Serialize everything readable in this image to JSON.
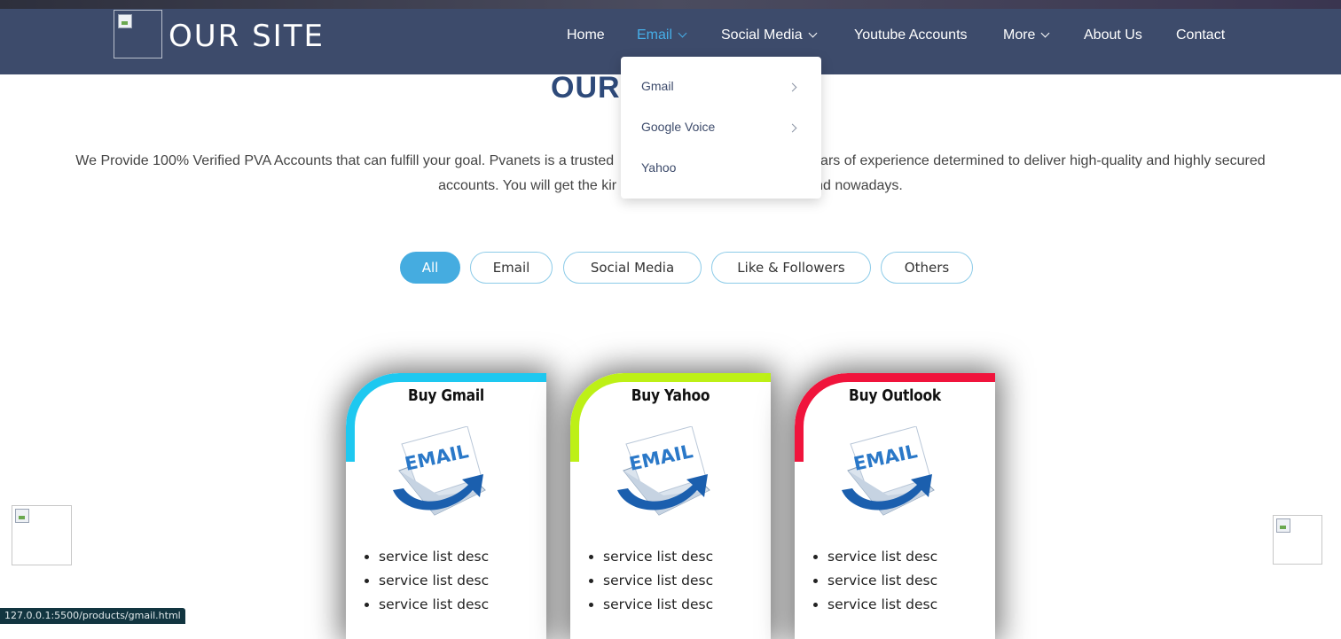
{
  "header": {
    "site_title": "OUR SITE",
    "nav": [
      "Home",
      "Email",
      "Social Media",
      "Youtube Accounts",
      "More",
      "About Us",
      "Contact"
    ],
    "active_nav": "Email"
  },
  "dropdown": {
    "items": [
      {
        "label": "Gmail",
        "has_submenu": true
      },
      {
        "label": "Google Voice",
        "has_submenu": true
      },
      {
        "label": "Yahoo",
        "has_submenu": false
      }
    ]
  },
  "section": {
    "title": "OUR",
    "intro_line1": "We Provide 100% Verified PVA Accounts that can fulfill your goal. Pvanets is a trusted",
    "intro_line1_end": "ears of experience determined to deliver high-quality and highly secured",
    "intro_line2_start": "accounts. You will get the kir",
    "intro_line2_end": "nd nowadays."
  },
  "filters": {
    "items": [
      "All",
      "Email",
      "Social Media",
      "Like & Followers",
      "Others"
    ],
    "active": "All"
  },
  "cards": [
    {
      "title": "Buy Gmail",
      "icon_text": "EMAIL",
      "accent": "#1ec8f0",
      "list": [
        "service list desc",
        "service list desc",
        "service list desc"
      ]
    },
    {
      "title": "Buy Yahoo",
      "icon_text": "EMAIL",
      "accent": "#bdf016",
      "list": [
        "service list desc",
        "service list desc",
        "service list desc"
      ]
    },
    {
      "title": "Buy Outlook",
      "icon_text": "EMAIL",
      "accent": "#f0143c",
      "list": [
        "service list desc",
        "service list desc",
        "service list desc"
      ]
    }
  ],
  "status_bar": "127.0.0.1:5500/products/gmail.html",
  "colors": {
    "navbar": "#3d4b6b",
    "active_link": "#46aee8",
    "pill_active": "#45ace0"
  }
}
